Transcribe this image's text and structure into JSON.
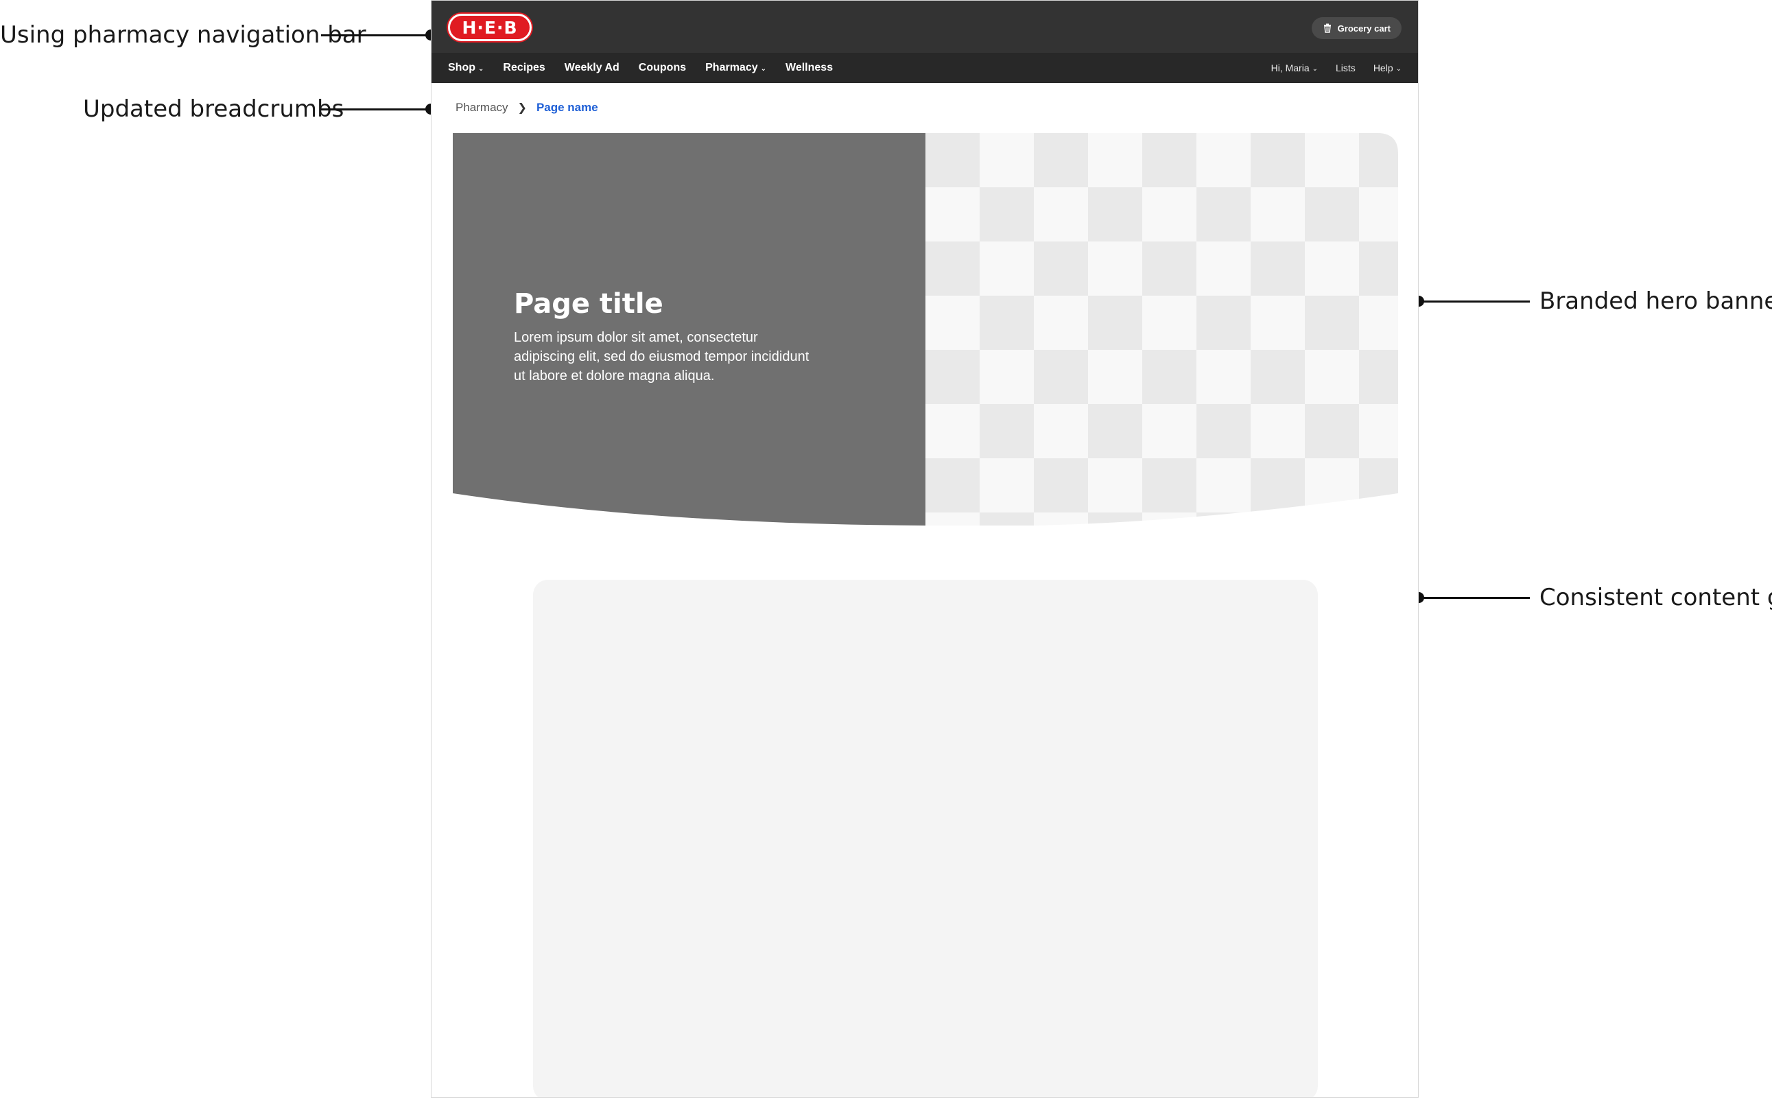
{
  "annotations": {
    "nav": "Using pharmacy navigation bar",
    "breadcrumbs": "Updated breadcrumbs",
    "hero": "Branded hero banner",
    "grid": "Consistent content grid"
  },
  "header": {
    "logo_text": "H·E·B",
    "cart_label": "Grocery cart",
    "cart_icon": "trash-can-icon"
  },
  "nav": {
    "left": [
      {
        "label": "Shop",
        "dropdown": true
      },
      {
        "label": "Recipes",
        "dropdown": false
      },
      {
        "label": "Weekly Ad",
        "dropdown": false
      },
      {
        "label": "Coupons",
        "dropdown": false
      },
      {
        "label": "Pharmacy",
        "dropdown": true
      },
      {
        "label": "Wellness",
        "dropdown": false
      }
    ],
    "right": [
      {
        "label": "Hi, Maria",
        "dropdown": true
      },
      {
        "label": "Lists",
        "dropdown": false
      },
      {
        "label": "Help",
        "dropdown": true
      }
    ]
  },
  "breadcrumb": {
    "home": "Pharmacy",
    "separator": "❯",
    "current": "Page name"
  },
  "hero": {
    "title": "Page title",
    "body": "Lorem ipsum dolor sit amet, consectetur adipiscing elit, sed do eiusmod tempor incididunt ut labore et dolore magna aliqua."
  },
  "colors": {
    "topbar": "#333333",
    "navbar": "#282828",
    "brand_red": "#e01b22",
    "hero_panel": "#707070",
    "link_blue": "#1e5fd6",
    "content_bg": "#f4f4f4"
  }
}
